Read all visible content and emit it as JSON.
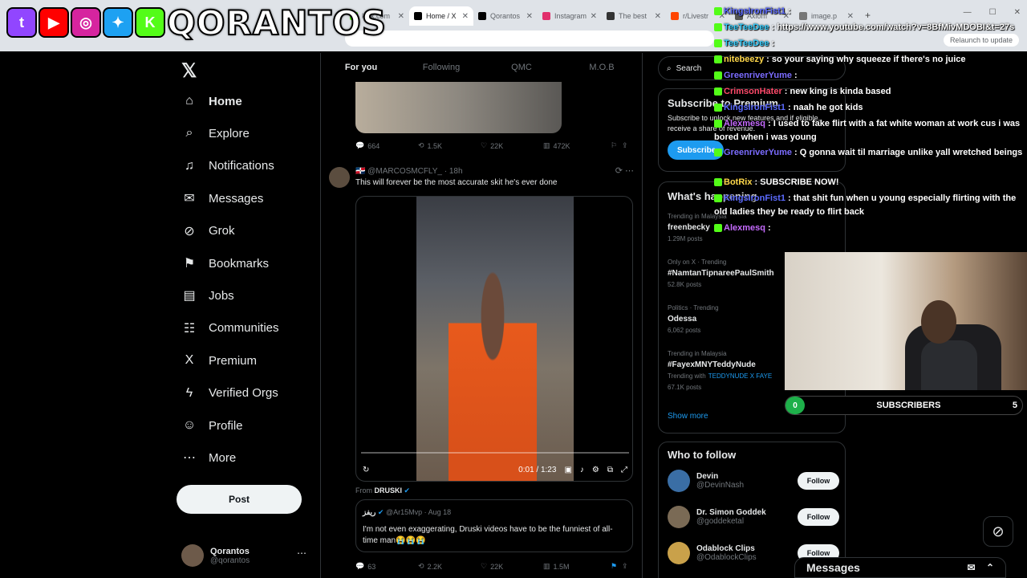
{
  "browser": {
    "tabs": [
      {
        "label": "kick.com",
        "color": "#53fc18"
      },
      {
        "label": "Home / X",
        "color": "#000000",
        "active": true
      },
      {
        "label": "Qorantos",
        "color": "#000000"
      },
      {
        "label": "Instagram",
        "color": "#e1306c"
      },
      {
        "label": "The best",
        "color": "#333333"
      },
      {
        "label": "r/Livestr",
        "color": "#ff4500"
      },
      {
        "label": "Axiom",
        "color": "#555555"
      },
      {
        "label": "image.p",
        "color": "#777777"
      }
    ],
    "relaunch": "Relaunch to update"
  },
  "brand": {
    "name": "QORANTOS",
    "socials": [
      {
        "name": "twitch-icon",
        "glyph": "t",
        "color": "#9146ff"
      },
      {
        "name": "youtube-icon",
        "glyph": "▶",
        "color": "#ff0000"
      },
      {
        "name": "instagram-icon",
        "glyph": "◎",
        "color": "#d6249f"
      },
      {
        "name": "twitter-icon",
        "glyph": "✦",
        "color": "#1da1f2"
      },
      {
        "name": "kick-icon",
        "glyph": "K",
        "color": "#53fc18"
      }
    ]
  },
  "nav": {
    "items": [
      {
        "label": "Home",
        "icon": "⌂",
        "name": "home"
      },
      {
        "label": "Explore",
        "icon": "⌕",
        "name": "explore"
      },
      {
        "label": "Notifications",
        "icon": "♫",
        "name": "notifications"
      },
      {
        "label": "Messages",
        "icon": "✉",
        "name": "messages"
      },
      {
        "label": "Grok",
        "icon": "⊘",
        "name": "grok"
      },
      {
        "label": "Bookmarks",
        "icon": "⚑",
        "name": "bookmarks"
      },
      {
        "label": "Jobs",
        "icon": "▤",
        "name": "jobs"
      },
      {
        "label": "Communities",
        "icon": "☷",
        "name": "communities"
      },
      {
        "label": "Premium",
        "icon": "X",
        "name": "premium"
      },
      {
        "label": "Verified Orgs",
        "icon": "ϟ",
        "name": "verified-orgs"
      },
      {
        "label": "Profile",
        "icon": "☺",
        "name": "profile"
      },
      {
        "label": "More",
        "icon": "⋯",
        "name": "more"
      }
    ],
    "post": "Post",
    "account": {
      "name": "Qorantos",
      "handle": "@qorantos"
    }
  },
  "feed": {
    "tabs": [
      "For you",
      "Following",
      "QMC",
      "M.O.B"
    ],
    "top_actions": {
      "replies": "664",
      "reposts": "1.5K",
      "likes": "22K",
      "views": "472K"
    },
    "tweet": {
      "author": "🇩🇴 @MARCOSMCFLY_ · 18h",
      "text": "This will forever be the most accurate skit he's ever done",
      "video_time": "0:01 / 1:23",
      "from_label": "From",
      "from_name": "DRUSKI",
      "quote_author": "ريفز",
      "quote_handle": "@Ar15Mvp · Aug 18",
      "quote_text": "I'm not even exaggerating, Druski videos have to be the funniest of all-time man😭😭😭",
      "actions": {
        "replies": "63",
        "reposts": "2.2K",
        "likes": "22K",
        "views": "1.5M"
      }
    }
  },
  "right": {
    "search": "Search",
    "premium": {
      "title": "Subscribe to Premium",
      "text": "Subscribe to unlock new features and if eligible, receive a share of revenue.",
      "button": "Subscribe"
    },
    "happening": {
      "title": "What's happening",
      "trends": [
        {
          "context": "Trending in Malaysia",
          "name": "freenbecky",
          "count": "1.29M posts"
        },
        {
          "context": "Only on X · Trending",
          "name": "#NamtanTipnareePaulSmith",
          "count": "52.8K posts"
        },
        {
          "context": "Politics · Trending",
          "name": "Odessa",
          "count": "6,062 posts"
        },
        {
          "context": "Trending in Malaysia",
          "name": "#FayexMNYTeddyNude",
          "count": "67.1K posts",
          "with_label": "Trending with",
          "with": "TEDDYNUDE X FAYE"
        }
      ],
      "show_more": "Show more"
    },
    "who_to_follow": {
      "title": "Who to follow",
      "people": [
        {
          "name": "Devin",
          "handle": "@DevinNash",
          "color": "#3a6ea5"
        },
        {
          "name": "Dr. Simon Goddek",
          "handle": "@goddeketal",
          "color": "#7a6a55"
        },
        {
          "name": "Odablock Clips",
          "handle": "@OdablockClips",
          "color": "#c9a14a"
        }
      ],
      "follow": "Follow"
    }
  },
  "chat": {
    "url": "https://www.youtube.com/watch?v=8BfMivMDOBI&t=27s",
    "messages": [
      {
        "user": "KingsIronFist1",
        "text": "",
        "color": "#5c6bff"
      },
      {
        "user": "TeeTeeDee",
        "text": "https://www.youtube.com/watch?v=8BfMivMDOBI&t=27s",
        "color": "#3ad0ff"
      },
      {
        "user": "TeeTeeDee",
        "text": "",
        "color": "#3ad0ff"
      },
      {
        "user": "nitebeezy",
        "text": "so your saying why squeeze if there's no juice",
        "color": "#ffd84a"
      },
      {
        "user": "GreenriverYume",
        "text": "",
        "color": "#7b6cff"
      },
      {
        "user": "CrimsonHater",
        "text": "new king is kinda based",
        "color": "#ff4a6a"
      },
      {
        "user": "KingsIronFist1",
        "text": "naah he got kids",
        "color": "#5c6bff"
      },
      {
        "user": "Alexmesq",
        "text": "I used to fake flirt with a fat white woman at work cus i was bored when i was young",
        "color": "#c66bff"
      },
      {
        "user": "GreenriverYume",
        "text": "Q gonna wait til marriage unlike yall wretched beings",
        "color": "#7b6cff"
      },
      {
        "user": "BotRix",
        "text": "SUBSCRIBE NOW!",
        "color": "#ffd84a"
      },
      {
        "user": "KingsIronFist1",
        "text": "that shit fun when u young especially flirting with the old ladies they be ready to flirt back",
        "color": "#5c6bff"
      },
      {
        "user": "Alexmesq",
        "text": "",
        "color": "#c66bff"
      }
    ]
  },
  "stream": {
    "subscribers_count": "0",
    "subscribers_label": "SUBSCRIBERS",
    "subscribers_goal": "5"
  },
  "drawer": {
    "label": "Messages"
  }
}
